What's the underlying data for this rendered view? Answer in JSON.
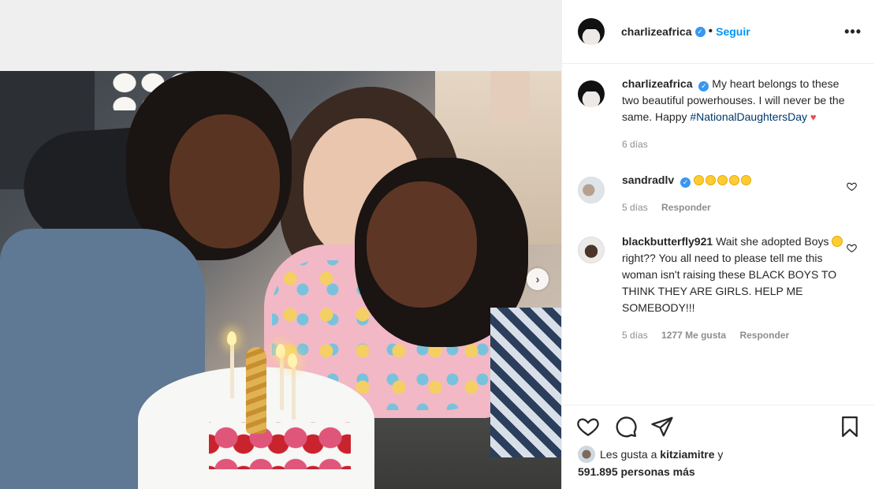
{
  "post": {
    "username": "charlizeafrica",
    "follow_label": "Seguir",
    "separator": "•",
    "more_label": "•••",
    "next_label": "›"
  },
  "caption": {
    "username": "charlizeafrica",
    "text": "My heart belongs to these two beautiful powerhouses. I will never be the same. Happy",
    "hashtag": "#NationalDaughtersDay",
    "heart": "♥",
    "time": "6 días"
  },
  "comments": [
    {
      "username": "sandradlv",
      "emoji_count": 5,
      "time": "5 días",
      "reply_label": "Responder"
    },
    {
      "username": "blackbutterfly921",
      "text_before": "Wait she adopted Boys",
      "text_after": "right?? You all need to please tell me this woman isn't raising these BLACK BOYS TO THINK THEY ARE GIRLS. HELP ME SOMEBODY!!!",
      "time": "5 días",
      "likes": "1277 Me gusta",
      "reply_label": "Responder"
    }
  ],
  "likes": {
    "prefix": "Les gusta a",
    "user": "kitziamitre",
    "conj": "y",
    "count": "591.895 personas más"
  },
  "icons": {
    "like": "heart-outline-icon",
    "comment": "comment-bubble-icon",
    "share": "paper-plane-icon",
    "save": "bookmark-icon",
    "verified": "verified-badge-icon"
  },
  "colors": {
    "accent": "#0095f6",
    "verified": "#3897f0",
    "hashtag": "#00376b",
    "meta": "#8e8e8e",
    "heart": "#ed4956"
  }
}
